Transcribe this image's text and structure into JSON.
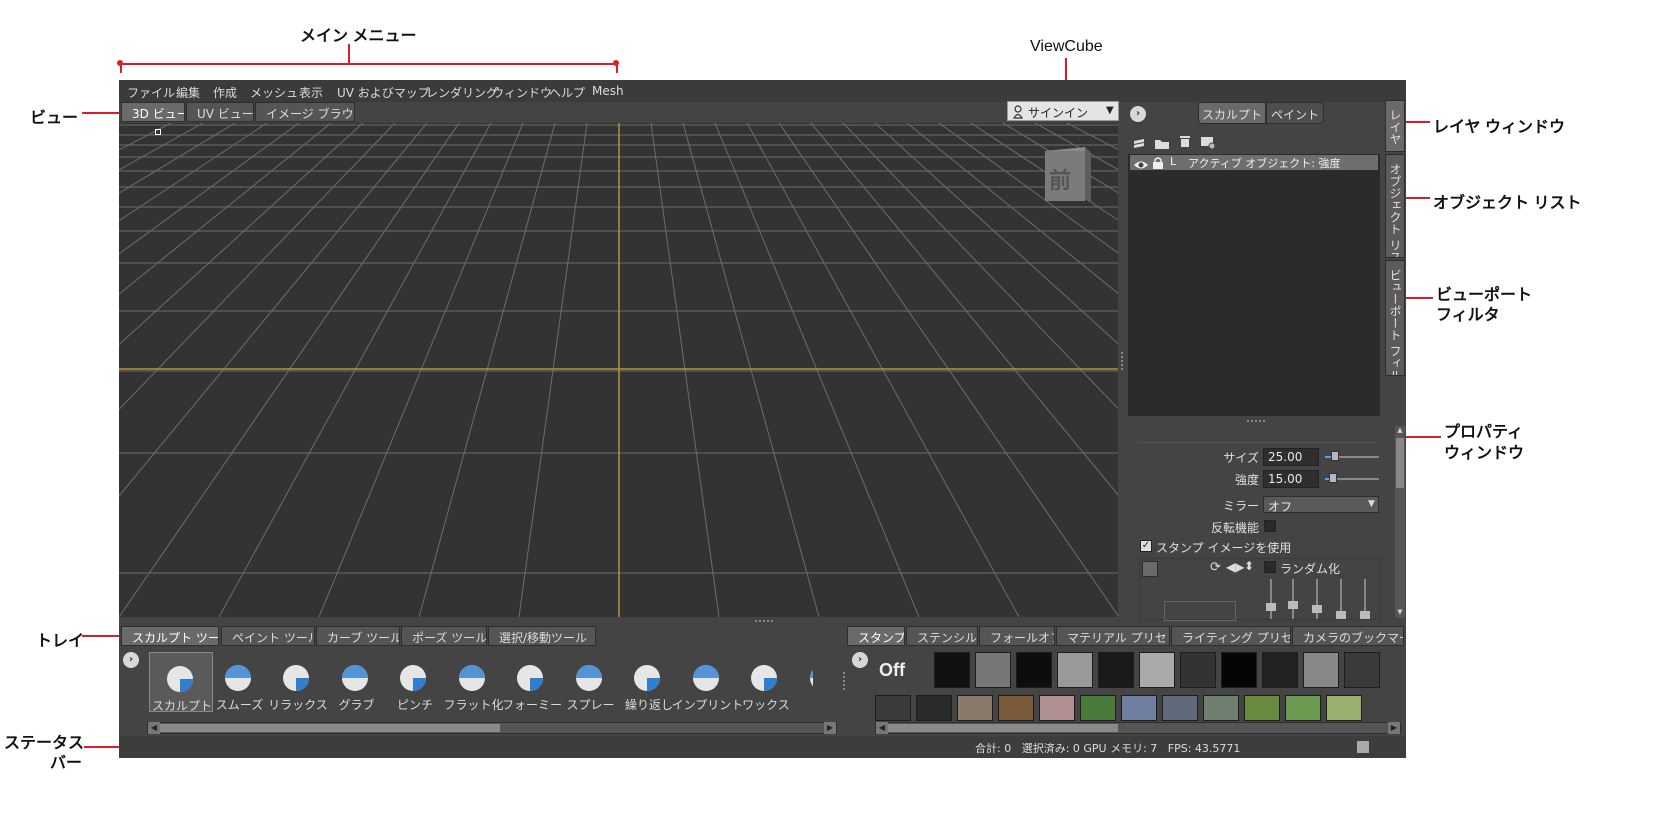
{
  "callouts": {
    "main_menu": "メイン メニュー",
    "view": "ビュー",
    "viewcube": "ViewCube",
    "layer_window": "レイヤ ウィンドウ",
    "object_list": "オブジェクト リスト",
    "viewport_filter_line1": "ビューポート",
    "viewport_filter_line2": "フィルタ",
    "property_window_line1": "プロパティ",
    "property_window_line2": "ウィンドウ",
    "tray": "トレイ",
    "status_bar_line1": "ステータス",
    "status_bar_line2": "バー"
  },
  "menu": [
    "ファイル",
    "編集",
    "作成",
    "メッシュ",
    "表示",
    "UV およびマップ",
    "レンダリング",
    "ウィンドウ",
    "ヘルプ",
    "Mesh"
  ],
  "view_tabs": [
    "3D ビュー",
    "UV ビュー",
    "イメージ ブラウザ"
  ],
  "signin": "サインイン",
  "viewcube_face": "前",
  "right_panel": {
    "mode_tabs": [
      "スカルプト",
      "ペイント"
    ],
    "side_tabs": [
      "レイヤ",
      "オブジェクト リスト",
      "ビューポート フィルタ"
    ],
    "layer_row": "アクティブ オブジェクト: 強度",
    "layer_flag": "L"
  },
  "properties": {
    "size_label": "サイズ",
    "size_value": "25.00",
    "size_fraction": 0.12,
    "strength_label": "強度",
    "strength_value": "15.00",
    "strength_fraction": 0.08,
    "mirror_label": "ミラー",
    "mirror_value": "オフ",
    "invert_label": "反転機能",
    "use_stamp_label": "スタンプ イメージを使用",
    "random_label": "ランダム化"
  },
  "tray": {
    "left_tabs": [
      "スカルプト ツール",
      "ペイント ツール",
      "カーブ ツール",
      "ポーズ ツール",
      "選択/移動ツール"
    ],
    "tools": [
      "スカルプト",
      "スムーズ",
      "リラックス",
      "グラブ",
      "ピンチ",
      "フラット化",
      "フォーミー",
      "スプレー",
      "繰り返し",
      "インプリント",
      "ワックス",
      "削"
    ],
    "right_tabs": [
      "スタンプ",
      "ステンシル",
      "フォールオフ",
      "マテリアル プリセット",
      "ライティング プリセット",
      "カメラのブックマーク"
    ],
    "stamp_off": "Off"
  },
  "status": "合計: 0   選択済み: 0 GPU メモリ: 7   FPS: 43.5771",
  "colors": {
    "accent_red": "#d7202a",
    "app_bg": "#444444",
    "viewport_bg": "#333333",
    "grid_axis": "#b8933a",
    "tool_blue": "#2f7fd0"
  }
}
